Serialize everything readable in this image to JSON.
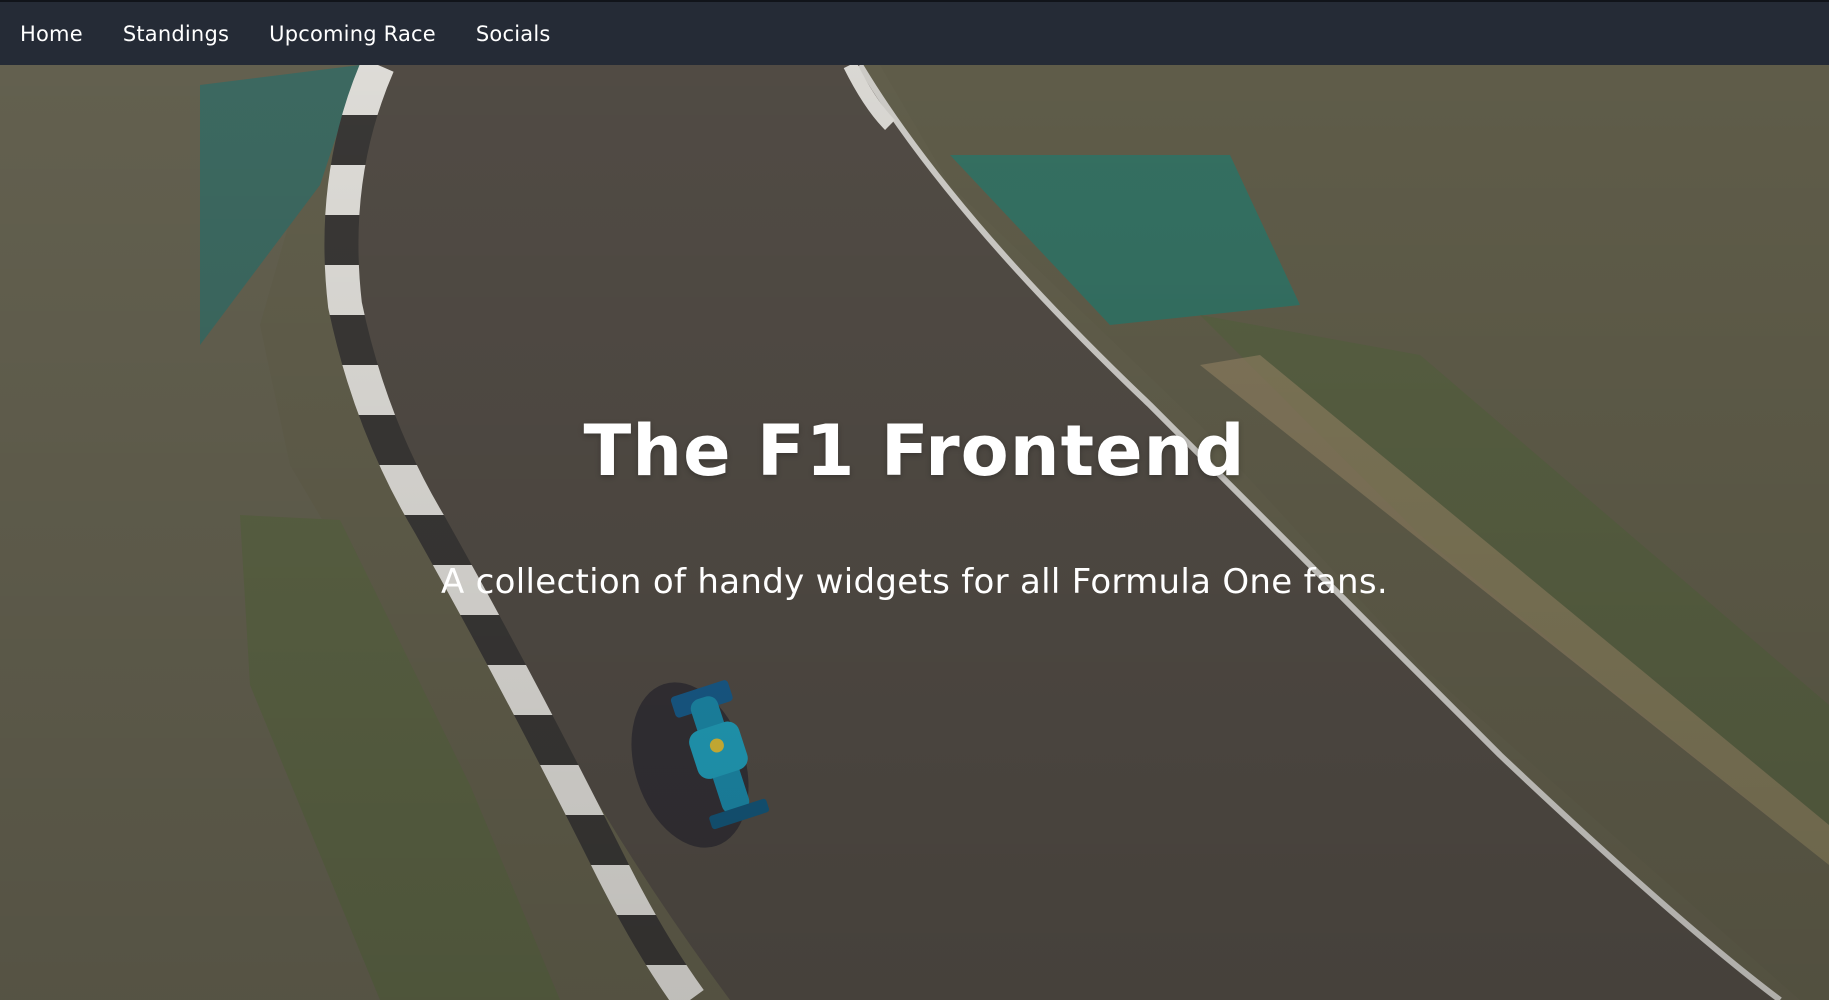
{
  "nav": {
    "items": [
      {
        "label": "Home"
      },
      {
        "label": "Standings"
      },
      {
        "label": "Upcoming Race"
      },
      {
        "label": "Socials"
      }
    ]
  },
  "hero": {
    "title": "The F1 Frontend",
    "subtitle": "A collection of handy widgets for all Formula One fans.",
    "background": "aerial-race-track-with-f1-car"
  },
  "colors": {
    "navbar": "#252b36",
    "text": "#ffffff",
    "track": "#545049",
    "grass": "#5e6645",
    "runoff_blue": "#2d7a6a"
  }
}
